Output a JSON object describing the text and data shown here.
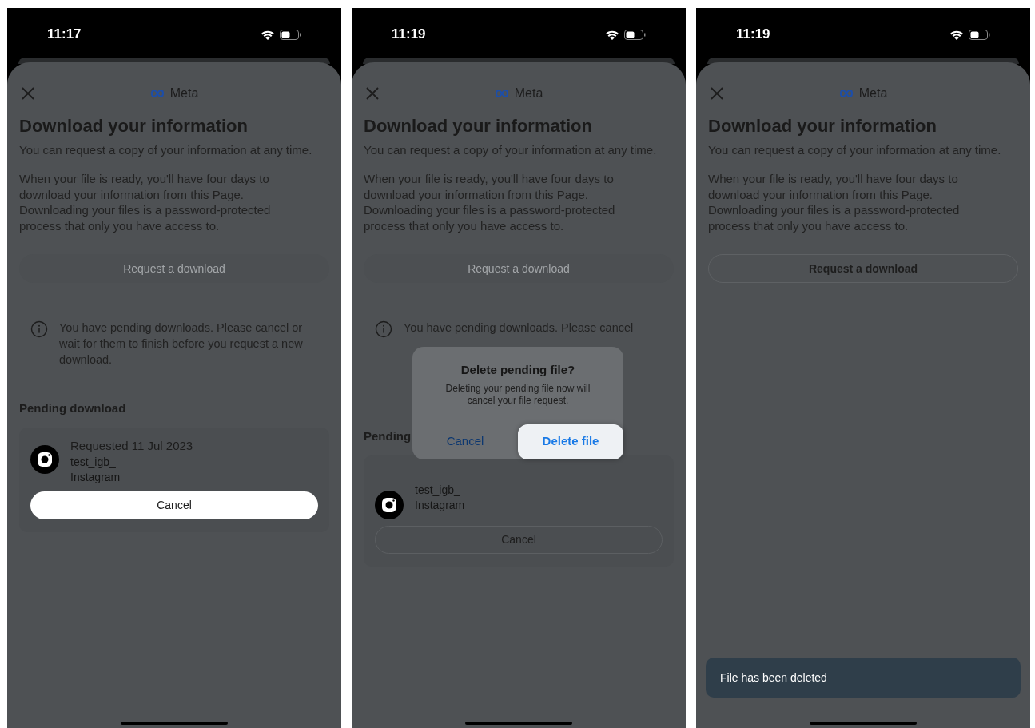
{
  "screens": [
    {
      "time": "11:17",
      "brand": "Meta",
      "title": "Download your information",
      "intro": "You can request a copy of your information at any time.",
      "body": "When your file is ready, you'll have four days to download your information from this Page. Downloading your files is a password-protected process that only you have access to.",
      "request_button": {
        "label": "Request a download",
        "disabled": true
      },
      "notice": "You have pending downloads. Please cancel or wait for them to finish before you request a new download.",
      "pending": {
        "heading": "Pending download",
        "requested": "Requested 11 Jul 2023",
        "account": "test_igb_",
        "app": "Instagram",
        "cancel_button": {
          "label": "Cancel",
          "highlighted": true
        }
      }
    },
    {
      "time": "11:19",
      "brand": "Meta",
      "title": "Download your information",
      "intro": "You can request a copy of your information at any time.",
      "body": "When your file is ready, you'll have four days to download your information from this Page. Downloading your files is a password-protected process that only you have access to.",
      "request_button": {
        "label": "Request a download",
        "disabled": true
      },
      "notice": "You have pending downloads. Please cancel",
      "pending": {
        "heading": "Pending",
        "account": "test_igb_",
        "app": "Instagram",
        "cancel_button": {
          "label": "Cancel",
          "highlighted": false
        }
      },
      "dialog": {
        "title": "Delete pending file?",
        "message": "Deleting your pending file now will cancel your file request.",
        "buttons": [
          {
            "label": "Cancel",
            "highlighted": false
          },
          {
            "label": "Delete file",
            "highlighted": true
          }
        ]
      }
    },
    {
      "time": "11:19",
      "brand": "Meta",
      "title": "Download your information",
      "intro": "You can request a copy of your information at any time.",
      "body": "When your file is ready, you'll have four days to download your information from this Page. Downloading your files is a password-protected process that only you have access to.",
      "request_button": {
        "label": "Request a download",
        "disabled": false
      },
      "toast": "File has been deleted"
    }
  ]
}
